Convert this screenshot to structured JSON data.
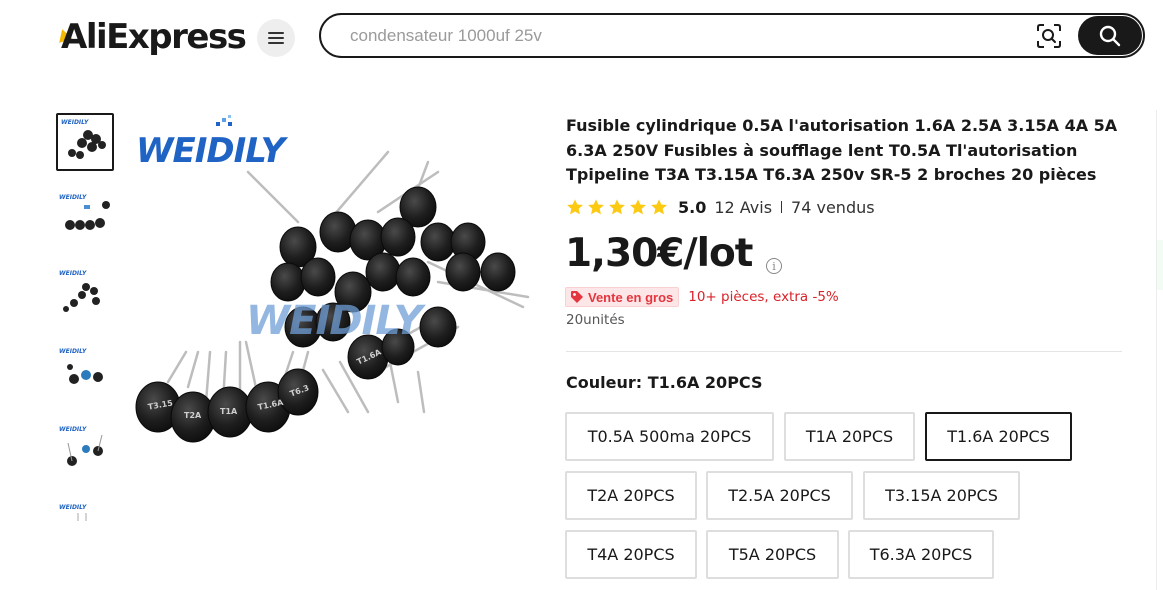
{
  "header": {
    "logo_text": "AliExpress",
    "menu_icon": "hamburger-menu-icon",
    "search": {
      "placeholder": "condensateur 1000uf 25v",
      "value": ""
    },
    "camera_icon": "camera-search-icon",
    "search_icon": "magnifier-icon"
  },
  "gallery": {
    "thumbnails": [
      "thumb-1",
      "thumb-2",
      "thumb-3",
      "thumb-4",
      "thumb-5",
      "thumb-6"
    ],
    "selected_index": 0,
    "brand_text": "WEIDILY",
    "watermark_text": "WEIDILY"
  },
  "product": {
    "title": "Fusible cylindrique 0.5A l'autorisation 1.6A 2.5A 3.15A 4A 5A 6.3A 250V Fusibles à soufflage lent T0.5A Tl'autorisation Tpipeline T3A T3.15A T6.3A 250v SR-5 2 broches 20 pièces",
    "rating": "5.0",
    "stars": 5,
    "reviews": "12 Avis",
    "sold": "74 vendus",
    "price": "1,30€/lot",
    "info_icon": "i",
    "bulk_badge": "Vente en gros",
    "bulk_text": "10+ pièces, extra -5%",
    "units": "20unités",
    "color_label": "Couleur: T1.6A 20PCS",
    "options": [
      "T0.5A 500ma 20PCS",
      "T1A 20PCS",
      "T1.6A 20PCS",
      "T2A 20PCS",
      "T2.5A 20PCS",
      "T3.15A 20PCS",
      "T4A 20PCS",
      "T5A 20PCS",
      "T6.3A 20PCS"
    ],
    "selected_option": "T1.6A 20PCS"
  },
  "colors": {
    "star": "#fcca13",
    "accent_red": "#e4363f",
    "brand_blue": "#1f63c4",
    "text_dark": "#191919"
  }
}
